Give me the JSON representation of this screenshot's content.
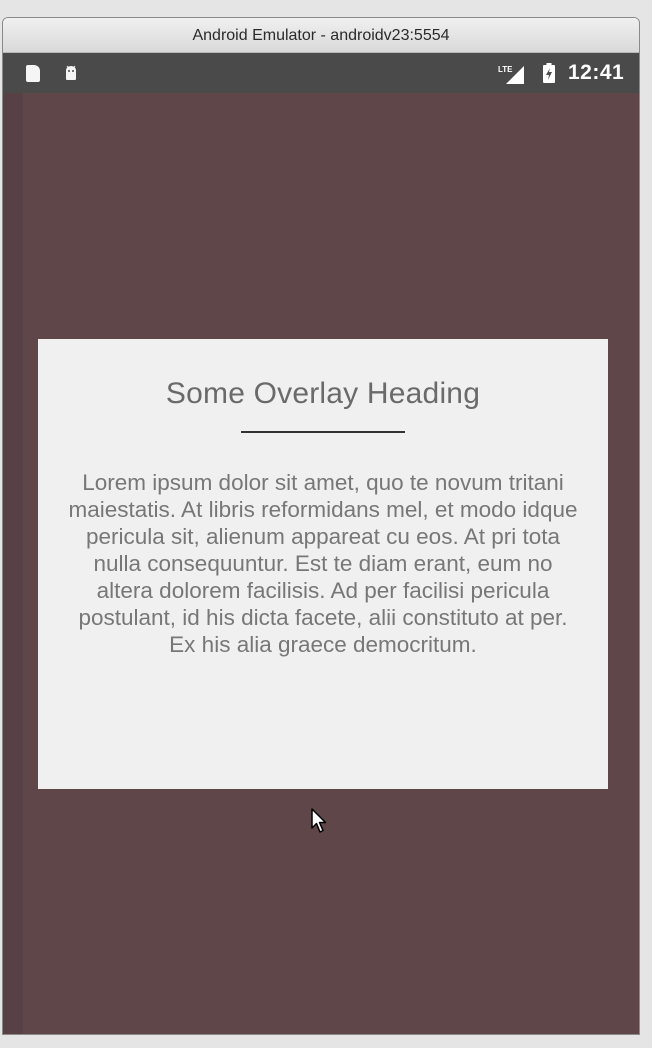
{
  "window": {
    "title": "Android Emulator - androidv23:5554"
  },
  "status_bar": {
    "left_icons": [
      "sd-card-icon",
      "android-icon"
    ],
    "right_icons": [
      "lte-signal-icon",
      "battery-icon"
    ],
    "network_label": "LTE",
    "time": "12:41"
  },
  "overlay": {
    "heading": "Some Overlay Heading",
    "body": "Lorem ipsum dolor sit amet, quo te novum tritani maiestatis. At libris reformidans mel, et modo idque pericula sit, alienum appareat cu eos. At pri tota nulla consequuntur. Est te diam erant, eum no altera dolorem facilisis. Ad per facilisi pericula postulant, id his dicta facete, alii constituto at per. Ex his alia graece democritum."
  },
  "colors": {
    "app_background": "#5e4649",
    "overlay_background": "#f1f0f0",
    "status_bar": "#4a4a4a"
  }
}
